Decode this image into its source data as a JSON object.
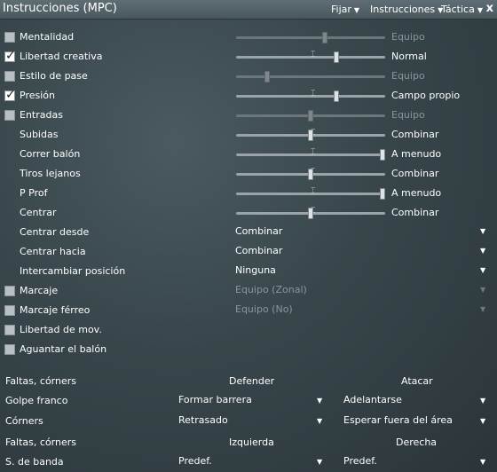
{
  "window": {
    "title": "Instrucciones (MPC)",
    "menus": [
      "Fijar",
      "Instrucciones",
      "Táctica"
    ],
    "close": "x"
  },
  "instructions": [
    {
      "label": "Mentalidad",
      "checkbox": true,
      "checked": false,
      "type": "slider",
      "level": 0.6,
      "value": "Equipo",
      "disabled": true
    },
    {
      "label": "Libertad creativa",
      "checkbox": true,
      "checked": true,
      "type": "slider",
      "level": 0.68,
      "value": "Normal",
      "disabled": false
    },
    {
      "label": "Estilo de pase",
      "checkbox": true,
      "checked": false,
      "type": "slider",
      "level": 0.2,
      "value": "Equipo",
      "disabled": true
    },
    {
      "label": "Presión",
      "checkbox": true,
      "checked": true,
      "type": "slider",
      "level": 0.68,
      "value": "Campo propio",
      "disabled": false
    },
    {
      "label": "Entradas",
      "checkbox": true,
      "checked": false,
      "type": "slider",
      "level": 0.5,
      "value": "Equipo",
      "disabled": true
    },
    {
      "label": "Subidas",
      "checkbox": false,
      "type": "slider",
      "level": 0.5,
      "value": "Combinar",
      "disabled": false
    },
    {
      "label": "Correr balón",
      "checkbox": false,
      "type": "slider",
      "level": 1.0,
      "value": "A menudo",
      "disabled": false
    },
    {
      "label": "Tiros lejanos",
      "checkbox": false,
      "type": "slider",
      "level": 0.5,
      "value": "Combinar",
      "disabled": false
    },
    {
      "label": "P Prof",
      "checkbox": false,
      "type": "slider",
      "level": 1.0,
      "value": "A menudo",
      "disabled": false
    },
    {
      "label": "Centrar",
      "checkbox": false,
      "type": "slider",
      "level": 0.5,
      "value": "Combinar",
      "disabled": false
    },
    {
      "label": "Centrar desde",
      "checkbox": false,
      "type": "dropdown",
      "value": "Combinar",
      "disabled": false
    },
    {
      "label": "Centrar hacia",
      "checkbox": false,
      "type": "dropdown",
      "value": "Combinar",
      "disabled": false
    },
    {
      "label": "Intercambiar posición",
      "checkbox": false,
      "type": "dropdown",
      "value": "Ninguna",
      "disabled": false
    },
    {
      "label": "Marcaje",
      "checkbox": true,
      "checked": false,
      "type": "dropdown",
      "value": "Equipo (Zonal)",
      "disabled": true
    },
    {
      "label": "Marcaje férreo",
      "checkbox": true,
      "checked": false,
      "type": "dropdown",
      "value": "Equipo (No)",
      "disabled": true
    },
    {
      "label": "Libertad de mov.",
      "checkbox": true,
      "checked": false,
      "type": "none"
    },
    {
      "label": "Aguantar el balón",
      "checkbox": true,
      "checked": false,
      "type": "none"
    }
  ],
  "set_pieces": {
    "header1": {
      "title": "Faltas, córners",
      "col1": "Defender",
      "col2": "Atacar"
    },
    "row1": {
      "label": "Golpe franco",
      "col1": "Formar barrera",
      "col2": "Adelantarse"
    },
    "row2": {
      "label": "Córners",
      "col1": "Retrasado",
      "col2": "Esperar fuera del área"
    },
    "header2": {
      "title": "Faltas, córners",
      "col1": "Izquierda",
      "col2": "Derecha"
    },
    "row3": {
      "label": "S. de banda",
      "col1": "Predef.",
      "col2": "Predef."
    }
  }
}
